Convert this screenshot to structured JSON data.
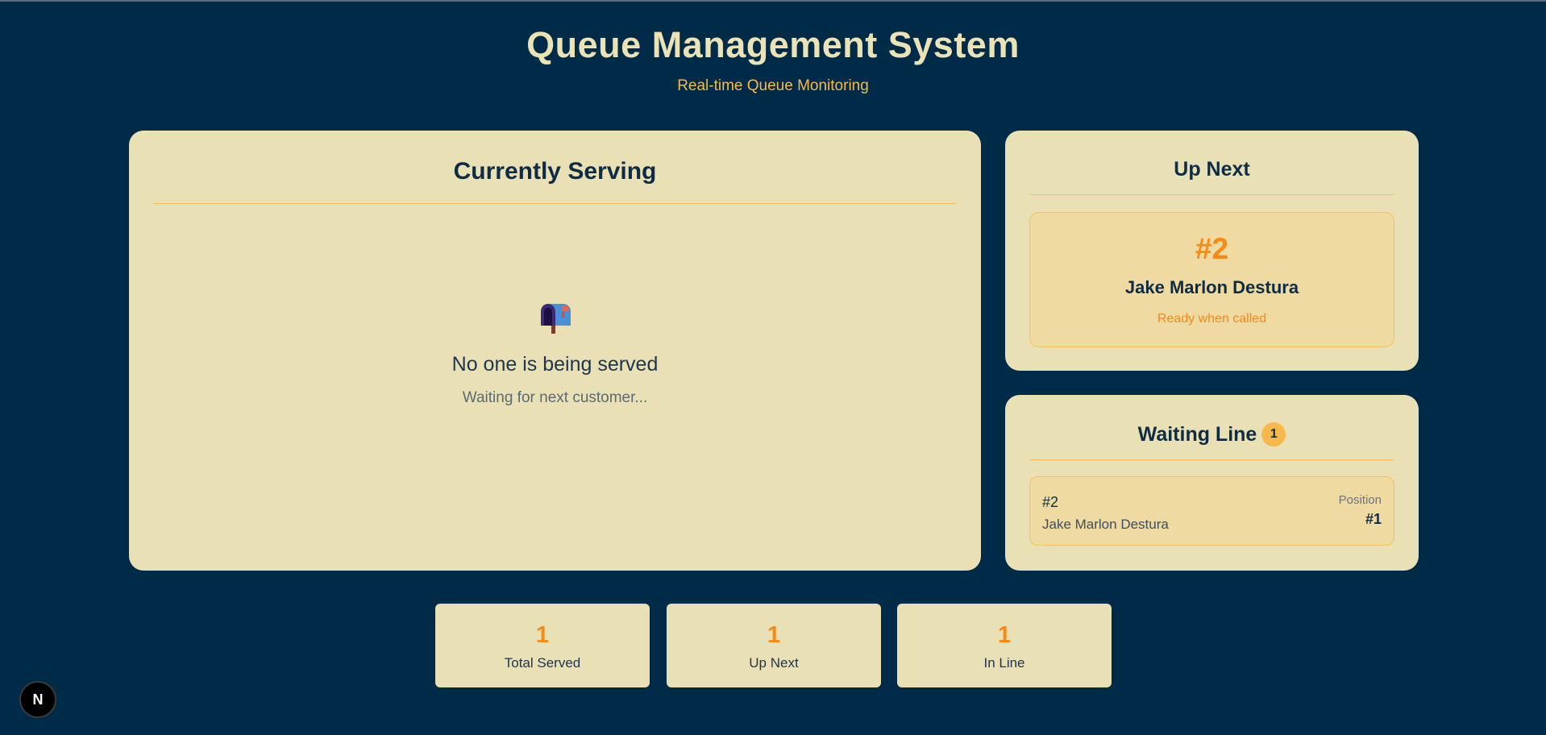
{
  "header": {
    "title": "Queue Management System",
    "subtitle": "Real-time Queue Monitoring"
  },
  "serving": {
    "title": "Currently Serving",
    "empty_icon": "mailbox-icon",
    "empty_title": "No one is being served",
    "empty_subtitle": "Waiting for next customer..."
  },
  "up_next": {
    "title": "Up Next",
    "ticket": "#2",
    "name": "Jake Marlon Destura",
    "status": "Ready when called"
  },
  "waiting_line": {
    "title": "Waiting Line",
    "count": "1",
    "items": [
      {
        "ticket": "#2",
        "name": "Jake Marlon Destura",
        "position_label": "Position",
        "position": "#1"
      }
    ]
  },
  "stats": {
    "total_served": {
      "value": "1",
      "label": "Total Served"
    },
    "up_next": {
      "value": "1",
      "label": "Up Next"
    },
    "in_line": {
      "value": "1",
      "label": "In Line"
    }
  },
  "dev_badge": {
    "letter": "N",
    "icon": "nextjs-icon"
  },
  "colors": {
    "background": "#002b48",
    "card": "#e9e1b5",
    "accent_orange": "#f68a17",
    "accent_yellow": "#f8b94c",
    "text_dark": "#0f2c45"
  }
}
